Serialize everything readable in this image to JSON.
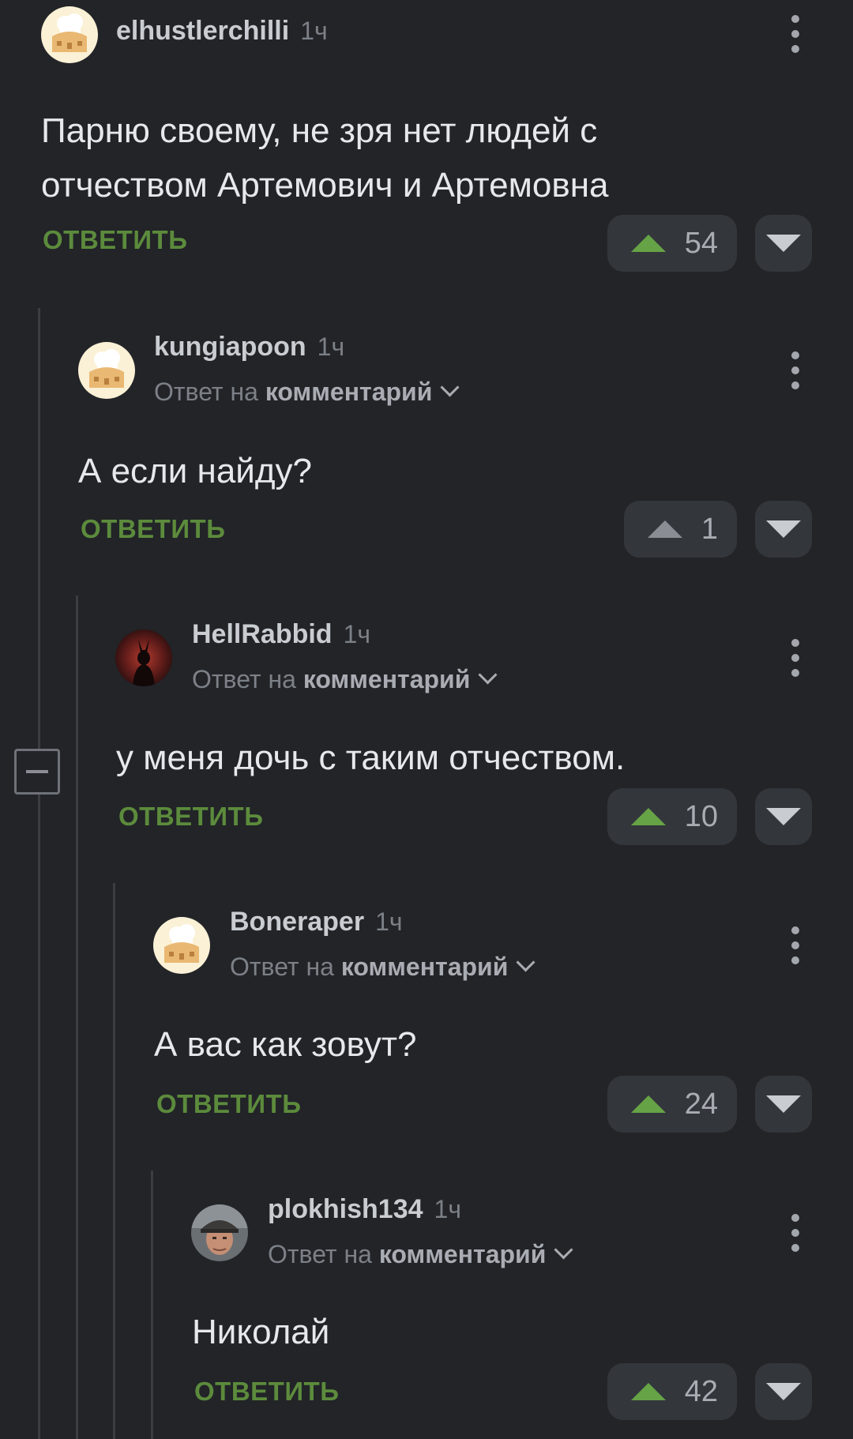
{
  "accent_color": "#5c8b3c",
  "upvote_color": "#66a346",
  "comments": [
    {
      "username": "elhustlerchilli",
      "time": "1ч",
      "reply_prefix": "",
      "reply_target": "",
      "text_lines": [
        "Парню своему, не зря нет людей с",
        "отчеством Артемович и Артемовна"
      ],
      "reply_label": "ОТВЕТИТЬ",
      "rating": "54",
      "avatar": "chef-hat-avatar-icon"
    },
    {
      "username": "kungiapoon",
      "time": "1ч",
      "reply_prefix": "Ответ на",
      "reply_target": "комментарий",
      "text_lines": [
        "А если найду?"
      ],
      "reply_label": "ОТВЕТИТЬ",
      "rating": "1",
      "avatar": "chef-hat-avatar-icon"
    },
    {
      "username": "HellRabbid",
      "time": "1ч",
      "reply_prefix": "Ответ на",
      "reply_target": "комментарий",
      "text_lines": [
        "у меня дочь с таким отчеством."
      ],
      "reply_label": "ОТВЕТИТЬ",
      "rating": "10",
      "avatar": "dark-rabbit-avatar-icon"
    },
    {
      "username": "Boneraper",
      "time": "1ч",
      "reply_prefix": "Ответ на",
      "reply_target": "комментарий",
      "text_lines": [
        "А вас как зовут?"
      ],
      "reply_label": "ОТВЕТИТЬ",
      "rating": "24",
      "avatar": "chef-hat-avatar-icon"
    },
    {
      "username": "plokhish134",
      "time": "1ч",
      "reply_prefix": "Ответ на",
      "reply_target": "комментарий",
      "text_lines": [
        "Николай"
      ],
      "reply_label": "ОТВЕТИТЬ",
      "rating": "42",
      "avatar": "man-with-cap-avatar-icon"
    }
  ]
}
